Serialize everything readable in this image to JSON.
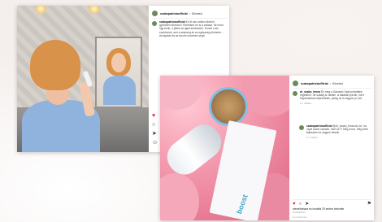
{
  "post1": {
    "username": "szabopatriciaofficial",
    "follow_label": "Követed",
    "caption_user": "szabopatriciaofficial",
    "caption_text": "Ez itt van amikor kiderül, gyűrötten ébredsz? Kerestem én is a választ, de most úgy tűnik, ú jöttek az igazi kérdéseim. Ennek a kis eszköznek, ami a szépség és az egészség ötvözete... Arcápolás és az arcom szívesen segít.",
    "actions": [
      "heart-icon",
      "comment-icon",
      "share-icon",
      "add-comment-icon"
    ]
  },
  "post2": {
    "username": "szabopatriciaofficial",
    "follow_label": "Követed",
    "comment1_user": "dr_szabo_timea",
    "comment1_text": "Én meg a Galvanic Spát próbáltam régebben, de sokáig is vártam. A hatásai nyerők, mert folyamatosan fejlesztetek, pedig az is nagyon jó volt.",
    "comment1_meta": "1 h   Válasz",
    "comment2_user": "szabopatriciaofficial",
    "comment2_text": "@dr_szabo_timea Az ál.. ha olyat tudod csinálni, mint ez?? Még nincs. Még több fejlesztés és nagyon tetszik",
    "comment2_meta": "1 h   Válasz",
    "likes_text": "drevelbahara és további 25 ember kedvelte",
    "date_text": "8 HÓNAPJA",
    "add_comment_placeholder": "Hozzászólás...",
    "device_brand": "boost"
  }
}
